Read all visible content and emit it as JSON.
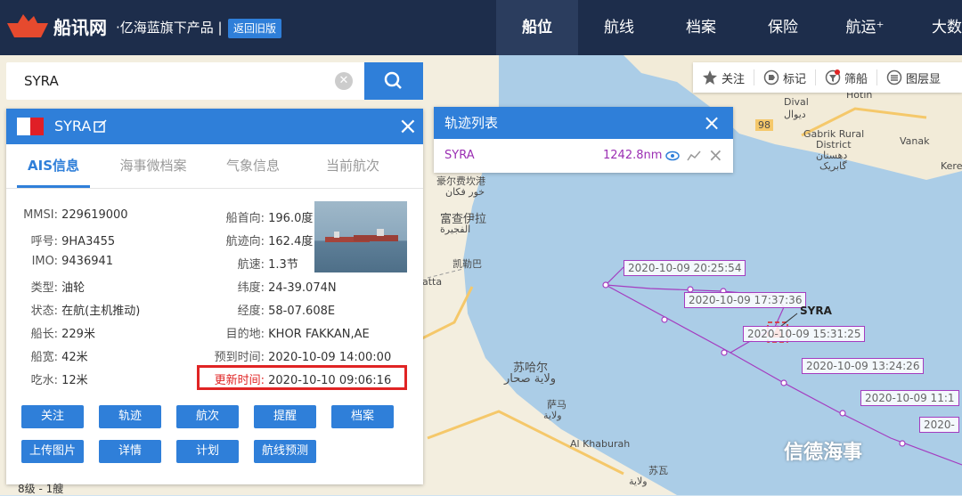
{
  "header": {
    "brand": "船讯网",
    "brand_sub": "·亿海蓝旗下产品 |",
    "old_version": "返回旧版",
    "nav": [
      "船位",
      "航线",
      "档案",
      "保险",
      "航运⁺",
      "大数"
    ]
  },
  "search": {
    "value": "SYRA"
  },
  "ship_panel": {
    "name": "SYRA",
    "tabs": [
      "AIS信息",
      "海事微档案",
      "气象信息",
      "当前航次"
    ],
    "left_fields": [
      {
        "k": "MMSI:",
        "v": "229619000"
      },
      {
        "k": "呼号:",
        "v": "9HA3455"
      },
      {
        "k": "IMO:",
        "v": "9436941"
      },
      {
        "k": "类型:",
        "v": "油轮"
      },
      {
        "k": "状态:",
        "v": "在航(主机推动)"
      },
      {
        "k": "船长:",
        "v": "229米"
      },
      {
        "k": "船宽:",
        "v": "42米"
      },
      {
        "k": "吃水:",
        "v": "12米"
      }
    ],
    "right_fields": [
      {
        "k": "船首向:",
        "v": "196.0度"
      },
      {
        "k": "航迹向:",
        "v": "162.4度"
      },
      {
        "k": "航速:",
        "v": "1.3节"
      },
      {
        "k": "纬度:",
        "v": "24-39.074N"
      },
      {
        "k": "经度:",
        "v": "58-07.608E"
      },
      {
        "k": "目的地:",
        "v": "KHOR FAKKAN,AE"
      },
      {
        "k": "预到时间:",
        "v": "2020-10-09 14:00:00"
      },
      {
        "k": "更新时间:",
        "v": "2020-10-10 09:06:16"
      }
    ],
    "buttons_row1": [
      "关注",
      "轨迹",
      "航次",
      "提醒",
      "档案"
    ],
    "buttons_row2": [
      "上传图片",
      "详情",
      "计划",
      "航线预测"
    ]
  },
  "track_list": {
    "title": "轨迹列表",
    "ship": "SYRA",
    "distance": "1242.8nm"
  },
  "map_tools": [
    "关注",
    "标记",
    "筛船",
    "图层显"
  ],
  "track_labels": [
    "2020-10-09 20:25:54",
    "2020-10-09 17:37:36",
    "2020-10-09 15:31:25",
    "2020-10-09 13:24:26",
    "2020-10-09 11:1",
    "2020-"
  ],
  "ship_label": "SYRA",
  "map_labels": [
    "Dival",
    "دیوال",
    "Hotin",
    "Gabrik Rural",
    "District",
    "دهستان",
    "گابریک",
    "Vanak",
    "Kere",
    "豪尔费坎港",
    "خور فكان",
    "富查伊拉",
    "الفجيرة",
    "凯勒巴",
    "atta",
    "苏哈尔",
    "ولاية صحار",
    "萨马",
    "ولاية",
    "Al Khaburah",
    "苏瓦",
    "ولاية",
    "98"
  ],
  "scale_text": "8级 - 1艘",
  "watermark": "信德海事",
  "colors": {
    "header": "#1d2d4b",
    "accent": "#2f7fd9",
    "track": "#a43cc0",
    "highlight": "#e02424"
  }
}
